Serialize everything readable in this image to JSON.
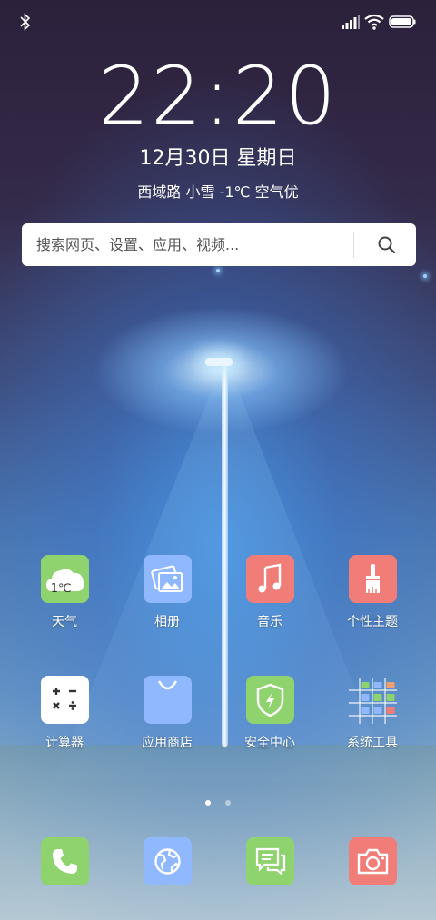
{
  "status_bar": {
    "bluetooth": "bluetooth-icon",
    "signal": "signal-icon",
    "wifi": "wifi-icon",
    "battery": "battery-icon"
  },
  "clock": {
    "time": "22:20",
    "date": "12月30日 星期日",
    "weather_line": "西域路 小雪 -1℃ 空气优"
  },
  "search": {
    "placeholder": "搜索网页、设置、应用、视频..."
  },
  "apps": [
    {
      "label": "天气",
      "icon": "weather-icon",
      "badge": "-1℃",
      "color": "#8fd36f"
    },
    {
      "label": "相册",
      "icon": "gallery-icon",
      "color": "#8fb8ff"
    },
    {
      "label": "音乐",
      "icon": "music-icon",
      "color": "#f07d77"
    },
    {
      "label": "个性主题",
      "icon": "themes-icon",
      "color": "#f07d77"
    },
    {
      "label": "计算器",
      "icon": "calculator-icon",
      "color": "#ffffff"
    },
    {
      "label": "应用商店",
      "icon": "app-store-icon",
      "color": "#8fb8ff"
    },
    {
      "label": "安全中心",
      "icon": "security-icon",
      "color": "#8fd36f"
    },
    {
      "label": "系统工具",
      "icon": "system-tools-folder-icon",
      "color": "transparent"
    }
  ],
  "dock": [
    {
      "icon": "phone-icon",
      "color": "#8fd36f"
    },
    {
      "icon": "browser-icon",
      "color": "#8fb8ff"
    },
    {
      "icon": "messages-icon",
      "color": "#8fd36f"
    },
    {
      "icon": "camera-icon",
      "color": "#f07d77"
    }
  ],
  "page_indicator": {
    "pages": 2,
    "current": 1
  }
}
